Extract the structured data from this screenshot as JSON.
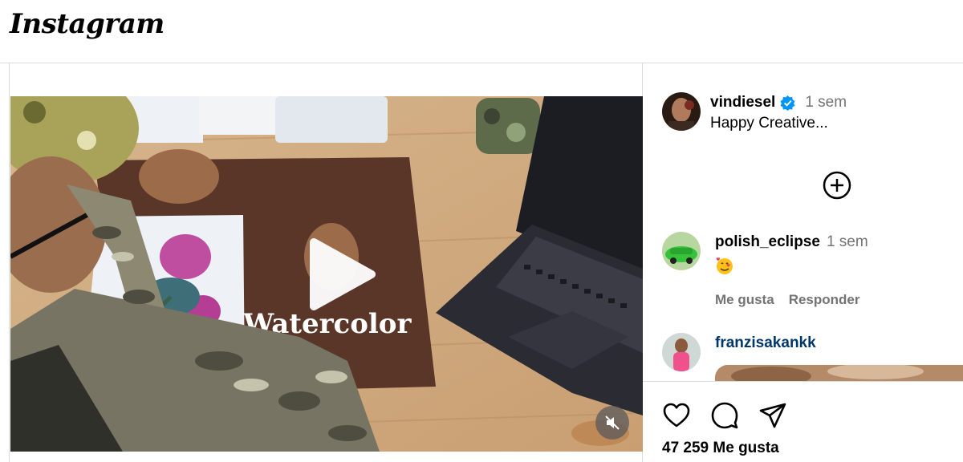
{
  "header": {
    "logo_text": "Instagram"
  },
  "post": {
    "author": {
      "username": "vindiesel",
      "verified": true,
      "time": "1 sem",
      "caption": "Happy Creative..."
    },
    "video": {
      "muted": true,
      "state": "paused"
    }
  },
  "comments": [
    {
      "username": "polish_eclipse",
      "time": "1 sem",
      "text_icon": "smiling-face-with-hearts-emoji",
      "like_label": "Me gusta",
      "reply_label": "Responder"
    },
    {
      "username": "franzisakankk"
    }
  ],
  "actions": {
    "likes_text": "47 259 Me gusta"
  },
  "icons": [
    "heart-icon",
    "comment-icon",
    "share-icon",
    "plus-circle-icon",
    "mute-icon",
    "play-icon",
    "verified-badge-icon"
  ],
  "colors": {
    "link": "#00376b",
    "secondary_text": "#737373",
    "verified": "#0095f6",
    "border": "#dbdbdb"
  }
}
